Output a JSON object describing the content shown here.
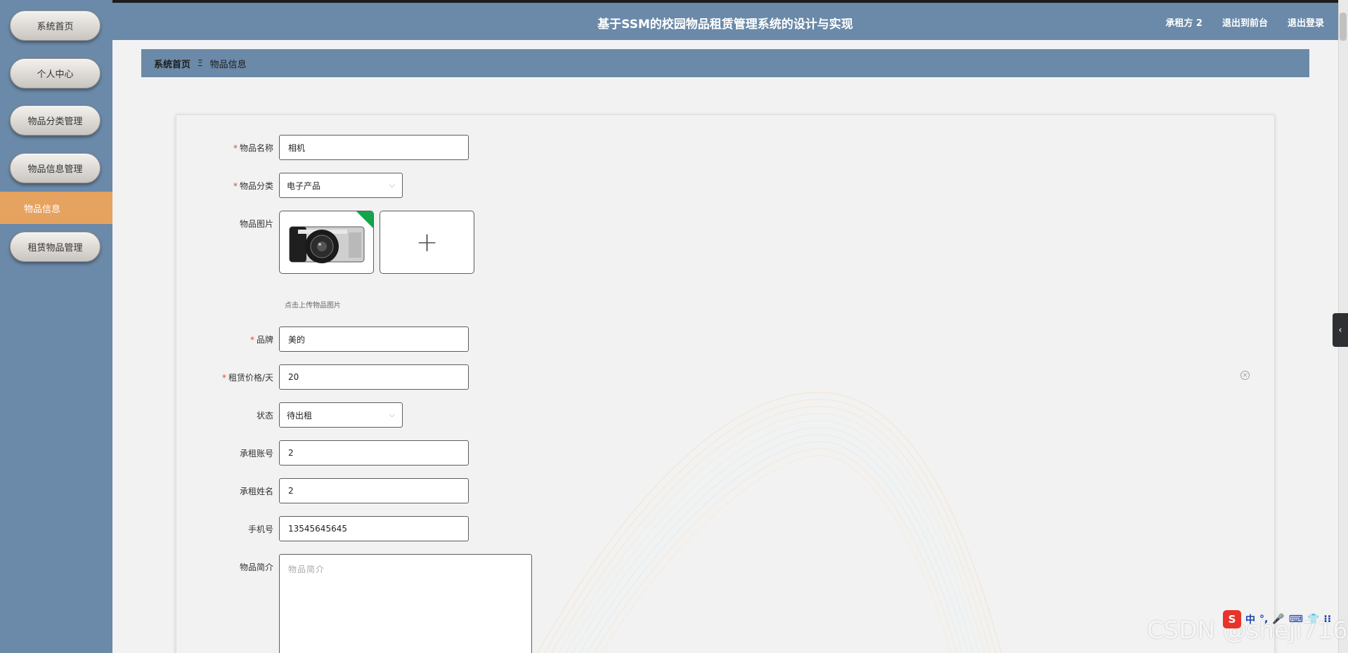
{
  "sidebar": {
    "items": [
      {
        "label": "系统首页"
      },
      {
        "label": "个人中心"
      },
      {
        "label": "物品分类管理"
      },
      {
        "label": "物品信息管理"
      },
      {
        "label": "物品信息"
      },
      {
        "label": "租赁物品管理"
      }
    ]
  },
  "header": {
    "title": "基于SSM的校园物品租赁管理系统的设计与实现",
    "user": "承租方 2",
    "back_label": "退出到前台",
    "logout_label": "退出登录"
  },
  "breadcrumb": {
    "home": "系统首页",
    "separator": "Ξ",
    "current": "物品信息"
  },
  "form": {
    "name": {
      "label": "物品名称",
      "value": "相机"
    },
    "category": {
      "label": "物品分类",
      "value": "电子产品"
    },
    "image": {
      "label": "物品图片",
      "hint": "点击上传物品图片"
    },
    "brand": {
      "label": "品牌",
      "value": "美的"
    },
    "price": {
      "label": "租赁价格/天",
      "value": "20"
    },
    "status": {
      "label": "状态",
      "value": "待出租"
    },
    "account": {
      "label": "承租账号",
      "value": "2"
    },
    "renter_name": {
      "label": "承租姓名",
      "value": "2"
    },
    "phone": {
      "label": "手机号",
      "value": "13545645645"
    },
    "intro": {
      "label": "物品简介",
      "placeholder": "物品简介"
    }
  },
  "ime": {
    "items": [
      "中",
      "°,",
      "🎤",
      "⌨",
      "👕",
      "⁝⁝"
    ]
  },
  "watermark": "CSDN @sheji716"
}
